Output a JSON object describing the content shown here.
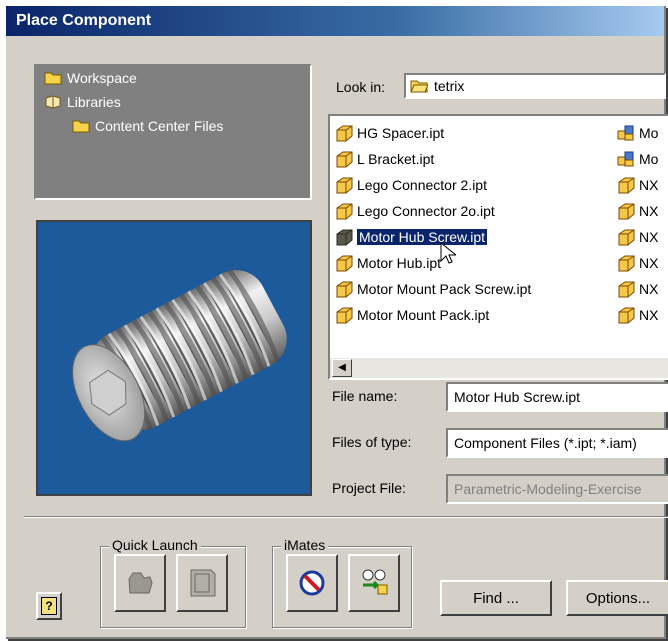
{
  "window": {
    "title": "Place Component"
  },
  "tree": {
    "items": [
      {
        "label": "Workspace",
        "icon": "folder-icon"
      },
      {
        "label": "Libraries",
        "icon": "library-icon"
      },
      {
        "label": "Content Center Files",
        "icon": "folder-icon"
      }
    ]
  },
  "preview": {
    "subject": "threaded socket screw preview"
  },
  "look_in": {
    "label": "Look in:",
    "value": "tetrix"
  },
  "files": {
    "column1": [
      "HG Spacer.ipt",
      "L Bracket.ipt",
      "Lego Connector 2.ipt",
      "Lego Connector 2o.ipt",
      "Motor Hub Screw.ipt",
      "Motor Hub.ipt",
      "Motor Mount Pack Screw.ipt",
      "Motor Mount Pack.ipt"
    ],
    "column2": [
      "Mo",
      "Mo",
      "NX",
      "NX",
      "NX",
      "NX",
      "NX",
      "NX"
    ],
    "selected": "Motor Hub Screw.ipt"
  },
  "form": {
    "file_name_label": "File name:",
    "file_name_value": "Motor Hub Screw.ipt",
    "files_of_type_label": "Files of type:",
    "files_of_type_value": "Component Files (*.ipt; *.iam)",
    "project_file_label": "Project File:",
    "project_file_value": "Parametric-Modeling-Exercise"
  },
  "quick_launch": {
    "label": "Quick Launch"
  },
  "imates": {
    "label": "iMates"
  },
  "buttons": {
    "help": "?",
    "find": "Find ...",
    "options": "Options..."
  },
  "colors": {
    "title_start": "#0a246a",
    "selection": "#0a246a",
    "preview_bg": "#1c5a9c",
    "dialog_bg": "#d4d0c8"
  }
}
